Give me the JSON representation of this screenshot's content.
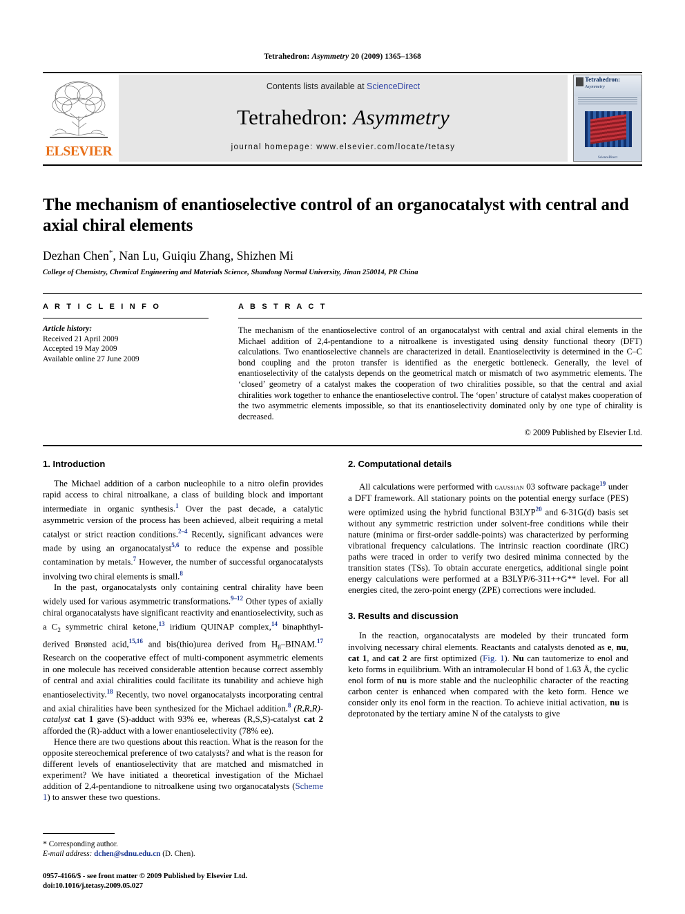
{
  "running_head": {
    "journal": "Tetrahedron:",
    "journal_italic": "Asymmetry",
    "citation": "20 (2009) 1365–1368"
  },
  "masthead": {
    "contents_prefix": "Contents lists available at ",
    "contents_link": "ScienceDirect",
    "journal_title_main": "Tetrahedron: ",
    "journal_title_italic": "Asymmetry",
    "homepage": "journal homepage: www.elsevier.com/locate/tetasy",
    "publisher_wordmark": "ELSEVIER",
    "cover_title": "Tetrahedron:",
    "cover_subtitle": "Asymmetry",
    "cover_footer": "ScienceDirect"
  },
  "article": {
    "title": "The mechanism of enantioselective control of an organocatalyst with central and axial chiral elements",
    "authors": "Dezhan Chen",
    "corresponding_marker": "*",
    "authors_rest": ", Nan Lu, Guiqiu Zhang, Shizhen Mi",
    "affiliation": "College of Chemistry, Chemical Engineering and Materials Science, Shandong Normal University, Jinan 250014, PR China"
  },
  "article_info": {
    "heading": "A R T I C L E   I N F O",
    "history_label": "Article history:",
    "received": "Received 21 April 2009",
    "accepted": "Accepted 19 May 2009",
    "available": "Available online 27 June 2009"
  },
  "abstract": {
    "heading": "A B S T R A C T",
    "text": "The mechanism of the enantioselective control of an organocatalyst with central and axial chiral elements in the Michael addition of 2,4-pentandione to a nitroalkene is investigated using density functional theory (DFT) calculations. Two enantioselective channels are characterized in detail. Enantioselectivity is determined in the C–C bond coupling and the proton transfer is identified as the energetic bottleneck. Generally, the level of enantioselectivity of the catalysts depends on the geometrical match or mismatch of two asymmetric elements. The ‘closed’ geometry of a catalyst makes the cooperation of two chiralities possible, so that the central and axial chiralities work together to enhance the enantioselective control. The ‘open’ structure of catalyst makes cooperation of the two asymmetric elements impossible, so that its enantioselectivity dominated only by one type of chirality is decreased.",
    "copyright": "© 2009 Published by Elsevier Ltd."
  },
  "sections": {
    "introduction_heading": "1. Introduction",
    "computational_heading": "2. Computational details",
    "results_heading": "3. Results and discussion"
  },
  "paragraphs": {
    "intro_p1_a": "The Michael addition of a carbon nucleophile to a nitro olefin provides rapid access to chiral nitroalkane, a class of building block and important intermediate in organic synthesis.",
    "intro_p1_r1": "1",
    "intro_p1_b": " Over the past decade, a catalytic asymmetric version of the process has been achieved, albeit requiring a metal catalyst or strict reaction conditions.",
    "intro_p1_r2": "2–4",
    "intro_p1_c": " Recently, significant advances were made by using an organocatalyst",
    "intro_p1_r3": "5,6",
    "intro_p1_d": " to reduce the expense and possible contamination by metals.",
    "intro_p1_r4": "7",
    "intro_p1_e": " However, the number of successful organocatalysts involving two chiral elements is small.",
    "intro_p1_r5": "8",
    "intro_p2_a": "In the past, organocatalysts only containing central chirality have been widely used for various asymmetric transformations.",
    "intro_p2_r1": "9–12",
    "intro_p2_b": " Other types of axially chiral organocatalysts have significant reactivity and enantioselectivity, such as a C",
    "intro_p2_sub": "2",
    "intro_p2_c": " symmetric chiral ketone,",
    "intro_p2_r2": "13",
    "intro_p2_d": " iridium QUINAP complex,",
    "intro_p2_r3": "14",
    "intro_p2_e": " binaphthyl-derived Brønsted acid,",
    "intro_p2_r4": "15,16",
    "intro_p2_f": " and bis(thio)urea derived from H",
    "intro_p2_sub2": "8",
    "intro_p2_g": "–BINAM.",
    "intro_p2_r5": "17",
    "intro_p2_h": " Research on the cooperative effect of multi-component asymmetric elements in one molecule has received considerable attention because correct assembly of central and axial chiralities could facilitate its tunability and achieve high enantioselectivity.",
    "intro_p2_r6": "18",
    "intro_p2_i": " Recently, two novel organocatalysts incorporating central and axial chiralities have been synthesized for the Michael addition.",
    "intro_p2_r7": "8",
    "intro_p2_j": " (R,R,R)-catalyst ",
    "intro_p2_cat1": "cat 1",
    "intro_p2_k": " gave (S)-adduct with 93% ee, whereas (R,S,S)-catalyst ",
    "intro_p2_cat2": "cat 2",
    "intro_p2_l": " afforded the (R)-adduct with a lower enantioselectivity (78% ee).",
    "intro_p3_a": "Hence there are two questions about this reaction. What is the reason for the opposite stereochemical preference of two catalysts? and what is the reason for different levels of enantioselectivity that are matched and mismatched in experiment? We have initiated a theoretical investigation of the Michael addition of 2,4-pentandione to nitroalkene using two organocatalysts (",
    "intro_p3_link": "Scheme 1",
    "intro_p3_b": ") to answer these two questions.",
    "comp_p1_a": "All calculations were performed with ",
    "comp_p1_sc": "gaussian",
    "comp_p1_b": " 03 software package",
    "comp_p1_r1": "19",
    "comp_p1_c": " under a DFT framework. All stationary points on the potential energy surface (PES) were optimized using the hybrid functional B3LYP",
    "comp_p1_r2": "20",
    "comp_p1_d": " and 6-31G(d) basis set without any symmetric restriction under solvent-free conditions while their nature (minima or first-order saddle-points) was characterized by performing vibrational frequency calculations. The intrinsic reaction coordinate (IRC) paths were traced in order to verify two desired minima connected by the transition states (TSs). To obtain accurate energetics, additional single point energy calculations were performed at a B3LYP/6-311++G** level. For all energies cited, the zero-point energy (ZPE) corrections were included.",
    "res_p1_a": "In the reaction, organocatalysts are modeled by their truncated form involving necessary chiral elements. Reactants and catalysts denoted as ",
    "res_p1_b1": "e",
    "res_p1_b": ", ",
    "res_p1_b2": "nu",
    "res_p1_c": ", ",
    "res_p1_b3": "cat 1",
    "res_p1_d": ", and ",
    "res_p1_b4": "cat 2",
    "res_p1_e": " are first optimized (",
    "res_p1_link": "Fig. 1",
    "res_p1_f": "). ",
    "res_p1_b5": "Nu",
    "res_p1_g": " can tautomerize to enol and keto forms in equilibrium. With an intramolecular H bond of 1.63 Å, the cyclic enol form of ",
    "res_p1_b6": "nu",
    "res_p1_h": " is more stable and the nucleophilic character of the reacting carbon center is enhanced when compared with the keto form. Hence we consider only its enol form in the reaction. To achieve initial activation, ",
    "res_p1_b7": "nu",
    "res_p1_i": " is deprotonated by the tertiary amine N of the catalysts to give"
  },
  "footnote": {
    "star": "*",
    "corresponding": "Corresponding author.",
    "email_label": "E-mail address:",
    "email": "dchen@sdnu.edu.cn",
    "email_owner": "(D. Chen)."
  },
  "page_footer": {
    "issn_line": "0957-4166/$ - see front matter © 2009 Published by Elsevier Ltd.",
    "doi_line": "doi:10.1016/j.tetasy.2009.05.027"
  },
  "colors": {
    "link": "#1f3a93",
    "sciencedirect": "#2b3fa5",
    "elsevier_orange": "#E8701A",
    "band_bg": "#e6e6e6"
  }
}
